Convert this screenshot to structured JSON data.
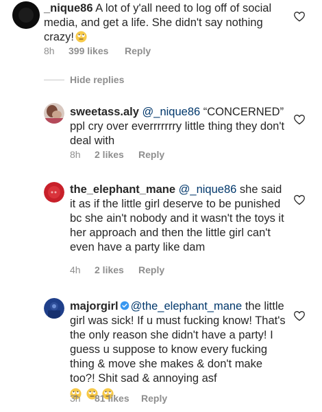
{
  "colors": {
    "text": "#262626",
    "secondary": "#8e8e8e",
    "mention": "#00376b"
  },
  "comments": [
    {
      "username": "_nique86",
      "mention": "",
      "text": " A lot of y'all need to log off of social media, and get a life. She didn't say nothing crazy!",
      "time": "8h",
      "likes": "399 likes",
      "reply": "Reply"
    },
    {
      "username": "sweetass.aly",
      "mention": "@_nique86",
      "text": "“CONCERNED” ppl cry over everrrrrrry little thing they don't deal with",
      "time": "8h",
      "likes": "2 likes",
      "reply": "Reply"
    },
    {
      "username": "the_elephant_mane",
      "mention": "@_nique86",
      "text": " she said it as if the little girl deserve to be punished bc she ain't nobody and it wasn't the toys it her approach and then the little girl can't even have a party like dam",
      "time": "4h",
      "likes": "2 likes",
      "reply": "Reply"
    },
    {
      "username": "majorgirl",
      "mention": "@the_elephant_mane",
      "text": " the little girl was sick! If u must fucking know! That's the only reason she didn't have a party! I guess u suppose to know every fucking thing & move she makes & don't make too?! Shit sad & annoying asf",
      "time": "3h",
      "likes": "81 likes",
      "reply": "Reply"
    }
  ],
  "hide_replies": "Hide replies",
  "icons": [
    "heart-outline-icon",
    "verified-badge-icon",
    "rolling-eyes-emoji"
  ]
}
